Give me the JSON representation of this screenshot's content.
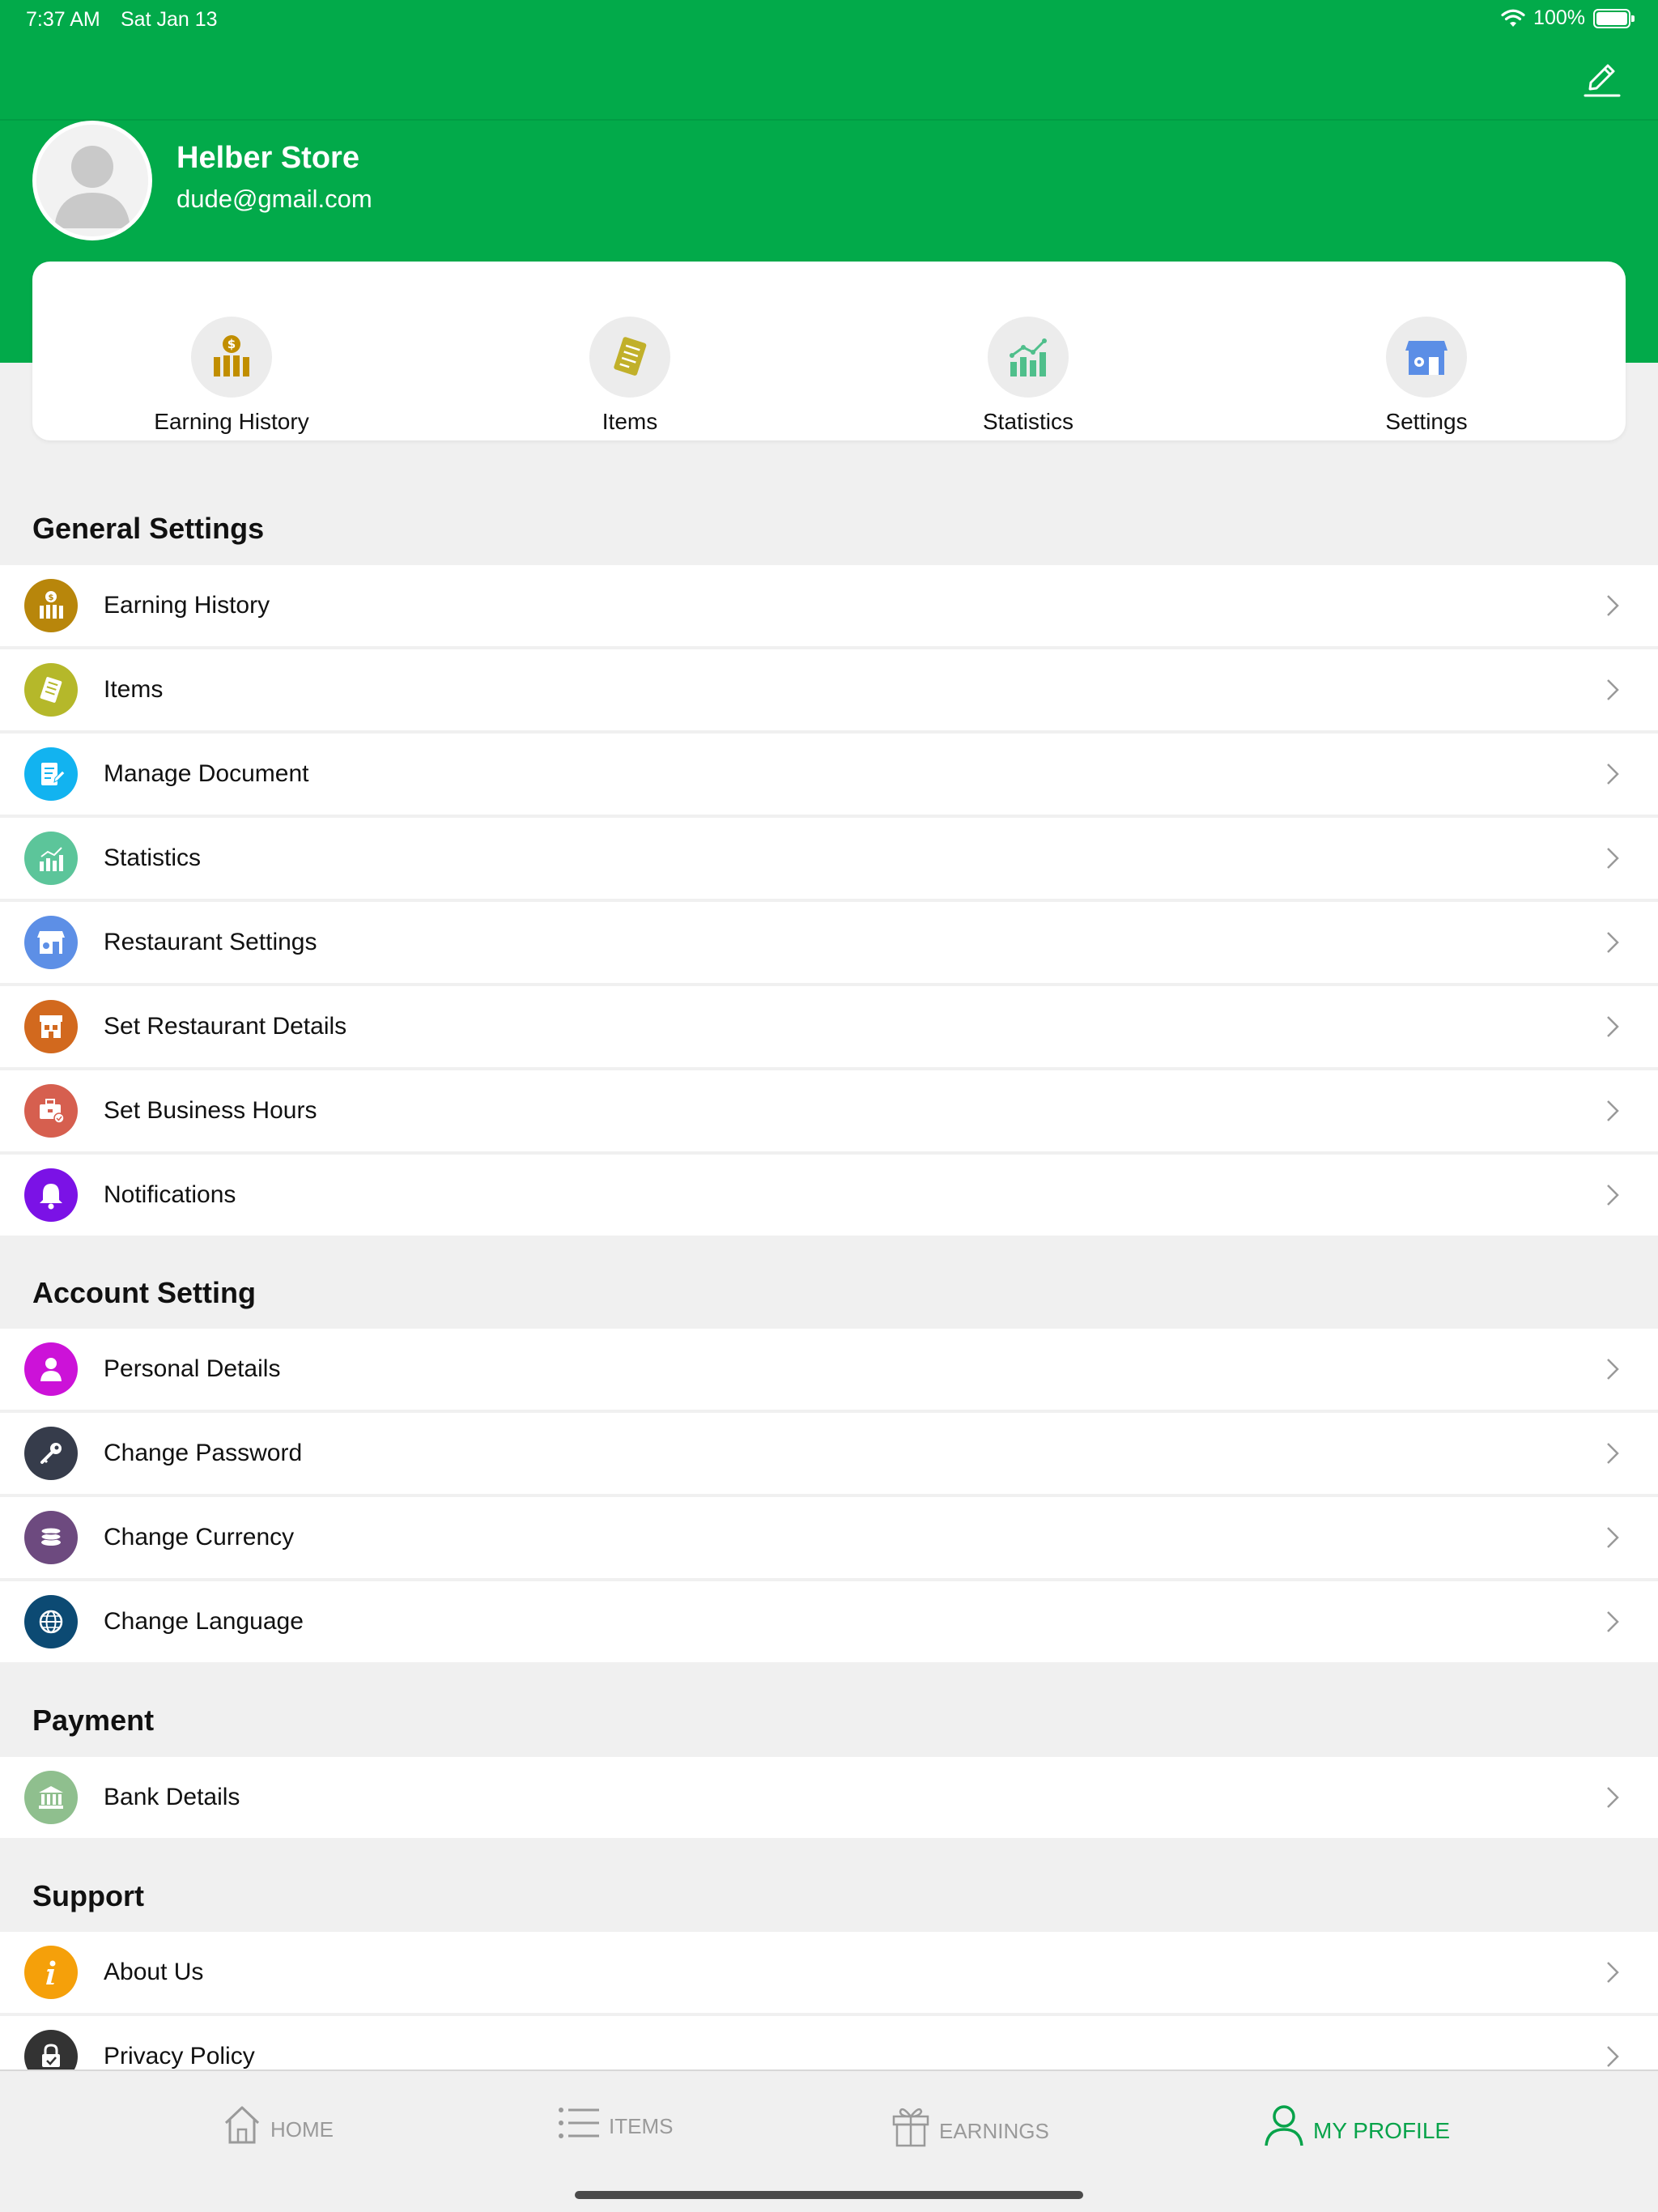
{
  "status_bar": {
    "time": "7:37 AM",
    "date": "Sat Jan 13",
    "battery": "100%"
  },
  "profile": {
    "name": "Helber Store",
    "email": "dude@gmail.com"
  },
  "quick_actions": [
    {
      "label": "Earning History",
      "icon": "earning-history-icon"
    },
    {
      "label": "Items",
      "icon": "items-icon"
    },
    {
      "label": "Statistics",
      "icon": "statistics-icon"
    },
    {
      "label": "Settings",
      "icon": "store-settings-icon"
    }
  ],
  "sections": {
    "general": {
      "title": "General Settings",
      "items": [
        {
          "label": "Earning History",
          "icon": "earning-history-icon",
          "color": "#b8860b"
        },
        {
          "label": "Items",
          "icon": "items-icon",
          "color": "#b5b82a"
        },
        {
          "label": "Manage Document",
          "icon": "document-edit-icon",
          "color": "#12b3f0"
        },
        {
          "label": "Statistics",
          "icon": "statistics-icon",
          "color": "#5cc59a"
        },
        {
          "label": "Restaurant Settings",
          "icon": "store-settings-icon",
          "color": "#5d8fe6"
        },
        {
          "label": "Set Restaurant Details",
          "icon": "restaurant-icon",
          "color": "#d2691e"
        },
        {
          "label": "Set Business Hours",
          "icon": "briefcase-clock-icon",
          "color": "#d65f4f"
        },
        {
          "label": "Notifications",
          "icon": "bell-icon",
          "color": "#7b12e6"
        }
      ]
    },
    "account": {
      "title": "Account Setting",
      "items": [
        {
          "label": "Personal Details",
          "icon": "person-icon",
          "color": "#cc12d8"
        },
        {
          "label": "Change Password",
          "icon": "key-icon",
          "color": "#363c4b"
        },
        {
          "label": "Change Currency",
          "icon": "coins-icon",
          "color": "#6d4a7f"
        },
        {
          "label": "Change Language",
          "icon": "globe-icon",
          "color": "#0c4a73"
        }
      ]
    },
    "payment": {
      "title": "Payment",
      "items": [
        {
          "label": "Bank Details",
          "icon": "bank-icon",
          "color": "#8fbf8e"
        }
      ]
    },
    "support": {
      "title": "Support",
      "items": [
        {
          "label": "About Us",
          "icon": "info-icon",
          "color": "#f5a00a"
        },
        {
          "label": "Privacy Policy",
          "icon": "privacy-lock-icon",
          "color": "#333333"
        }
      ]
    }
  },
  "tab_bar": {
    "tabs": [
      {
        "label": "HOME",
        "icon": "home-icon",
        "active": false
      },
      {
        "label": "ITEMS",
        "icon": "list-icon",
        "active": false
      },
      {
        "label": "EARNINGS",
        "icon": "gift-icon",
        "active": false
      },
      {
        "label": "MY PROFILE",
        "icon": "user-icon",
        "active": true
      }
    ]
  },
  "colors": {
    "brand_green": "#02aa4a",
    "active_tab": "#07a34a",
    "inactive_tab": "#9a9a9a",
    "background": "#f0f0f0"
  }
}
